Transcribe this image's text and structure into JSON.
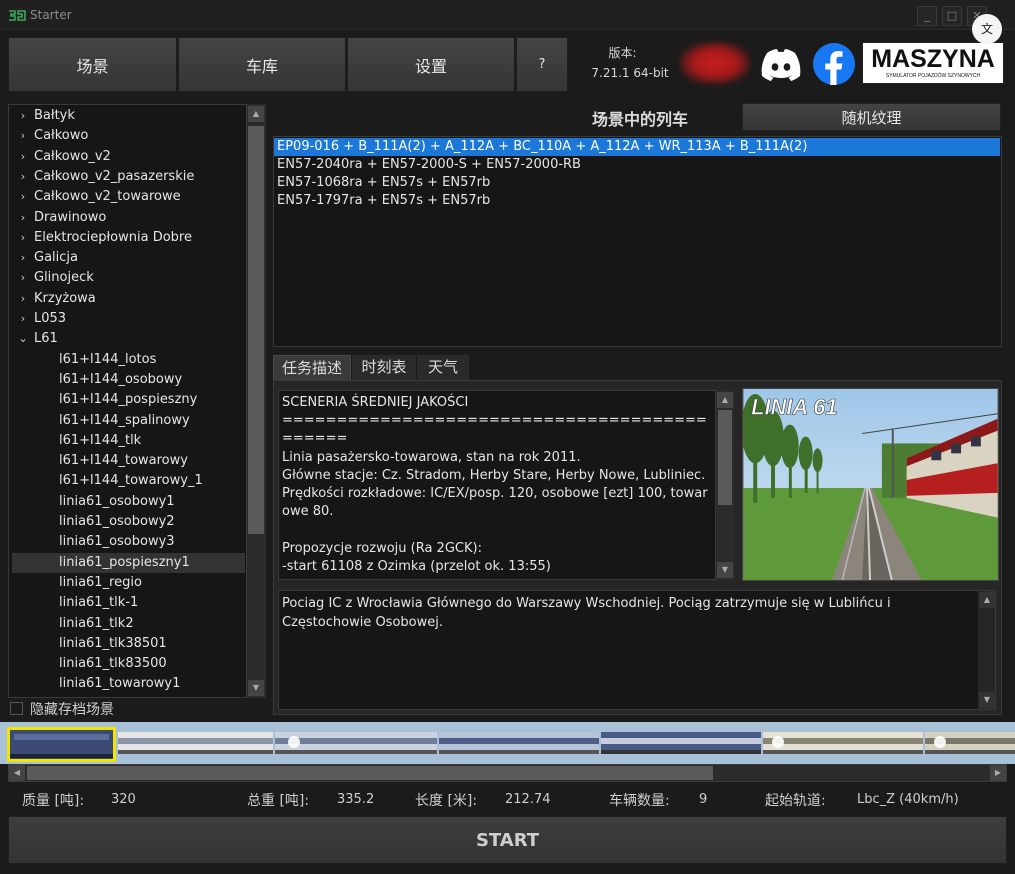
{
  "window": {
    "title": "Starter",
    "minimize": "_",
    "maximize": "□",
    "close": "✕"
  },
  "toolbar": {
    "scenario_label": "场景",
    "depot_label": "车库",
    "settings_label": "设置",
    "help_label": "?",
    "version_label": "版本:",
    "version_value": "7.21.1 64-bit",
    "maszyna_text": "MASZYNA",
    "maszyna_sub": "SYMULATOR POJAZDÓW SZYNOWYCH",
    "translate_icon": "文"
  },
  "tree": {
    "items": [
      {
        "label": "Bałtyk",
        "type": "folder",
        "chevron": "›"
      },
      {
        "label": "Całkowo",
        "type": "folder",
        "chevron": "›"
      },
      {
        "label": "Całkowo_v2",
        "type": "folder",
        "chevron": "›"
      },
      {
        "label": "Całkowo_v2_pasazerskie",
        "type": "folder",
        "chevron": "›"
      },
      {
        "label": "Całkowo_v2_towarowe",
        "type": "folder",
        "chevron": "›"
      },
      {
        "label": "Drawinowo",
        "type": "folder",
        "chevron": "›"
      },
      {
        "label": "Elektrociepłownia Dobre",
        "type": "folder",
        "chevron": "›"
      },
      {
        "label": "Galicja",
        "type": "folder",
        "chevron": "›"
      },
      {
        "label": "Glinojeck",
        "type": "folder",
        "chevron": "›"
      },
      {
        "label": "Krzyżowa",
        "type": "folder",
        "chevron": "›"
      },
      {
        "label": "L053",
        "type": "folder",
        "chevron": "›"
      },
      {
        "label": "L61",
        "type": "folder-open",
        "chevron": "⌄"
      },
      {
        "label": "l61+l144_lotos",
        "type": "child"
      },
      {
        "label": "l61+l144_osobowy",
        "type": "child"
      },
      {
        "label": "l61+l144_pospieszny",
        "type": "child"
      },
      {
        "label": "l61+l144_spalinowy",
        "type": "child"
      },
      {
        "label": "l61+l144_tlk",
        "type": "child"
      },
      {
        "label": "l61+l144_towarowy",
        "type": "child"
      },
      {
        "label": "l61+l144_towarowy_1",
        "type": "child"
      },
      {
        "label": "linia61_osobowy1",
        "type": "child"
      },
      {
        "label": "linia61_osobowy2",
        "type": "child"
      },
      {
        "label": "linia61_osobowy3",
        "type": "child"
      },
      {
        "label": "linia61_pospieszny1",
        "type": "child",
        "selected": true
      },
      {
        "label": "linia61_regio",
        "type": "child"
      },
      {
        "label": "linia61_tlk-1",
        "type": "child"
      },
      {
        "label": "linia61_tlk2",
        "type": "child"
      },
      {
        "label": "linia61_tlk38501",
        "type": "child"
      },
      {
        "label": "linia61_tlk83500",
        "type": "child"
      },
      {
        "label": "linia61_towarowy1",
        "type": "child"
      }
    ],
    "hide_saved_label": "隐藏存档场景",
    "hide_saved_checked": false
  },
  "trains": {
    "header": "场景中的列车",
    "random_texture_label": "随机纹理",
    "items": [
      {
        "label": "EP09-016 + B_111A(2) + A_112A + BC_110A + A_112A + WR_113A + B_111A(2)",
        "selected": true
      },
      {
        "label": "EN57-2040ra + EN57-2000-S + EN57-2000-RB"
      },
      {
        "label": "EN57-1068ra + EN57s + EN57rb"
      },
      {
        "label": "EN57-1797ra + EN57s + EN57rb"
      }
    ]
  },
  "description": {
    "tabs": [
      "任务描述",
      "时刻表",
      "天气"
    ],
    "active_tab": 0,
    "text": "SCENERIA ŚREDNIEJ JAKOŚCI\n=============================================\nLinia pasażersko-towarowa, stan na rok 2011.\nGłówne stacje: Cz. Stradom, Herby Stare, Herby Nowe, Lubliniec.\nPrędkości rozkładowe: IC/EX/posp. 120, osobowe [ezt] 100, towarowe 80.\n\nPropozycje rozwoju (Ra 2GCK):\n-start 61108 z Ozimka (przelot ok. 13:55)",
    "image_caption": "LINIA 61",
    "info": "Pociag IC z Wrocławia Głównego do Warszawy Wschodniej. Pociąg zatrzymuje się w Lublińcu i Częstochowie Osobowej."
  },
  "stats": {
    "mass_label": "质量 [吨]:",
    "mass_value": "320",
    "total_label": "总重 [吨]:",
    "total_value": "335.2",
    "length_label": "长度 [米]:",
    "length_value": "212.74",
    "count_label": "车辆数量:",
    "count_value": "9",
    "track_label": "起始轨道:",
    "track_value": "Lbc_Z (40km/h)"
  },
  "start_label": "START",
  "colors": {
    "selection": "#1c78d8",
    "consist_highlight": "#f2e600",
    "discord": "#ffffff",
    "facebook": "#1877f2"
  }
}
